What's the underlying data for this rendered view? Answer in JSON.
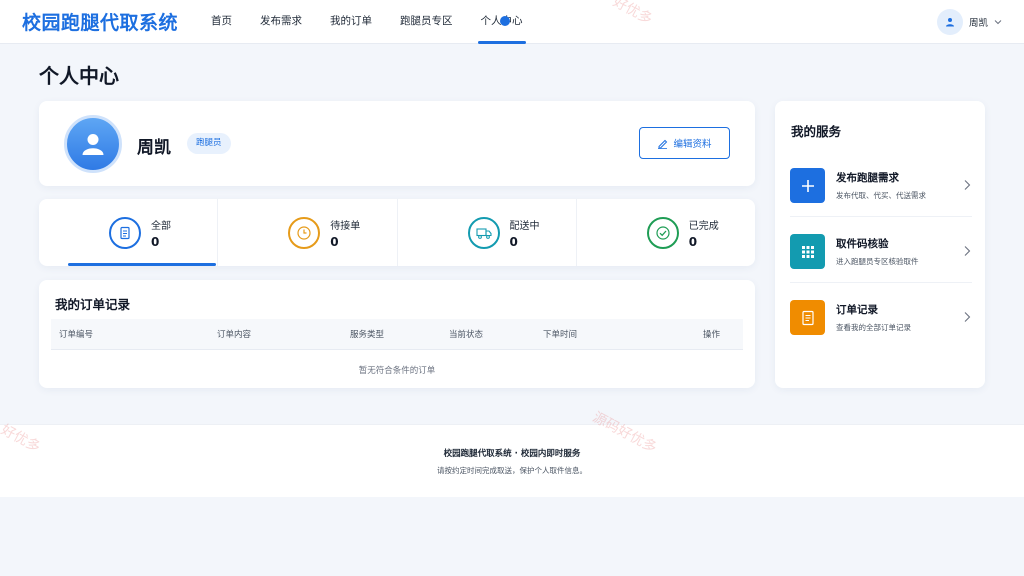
{
  "header": {
    "brand": "校园跑腿代取系统",
    "nav": [
      {
        "label": "首页"
      },
      {
        "label": "发布需求"
      },
      {
        "label": "我的订单"
      },
      {
        "label": "跑腿员专区"
      },
      {
        "label": "个人中心",
        "active": true
      }
    ],
    "user_name": "周凯"
  },
  "page_title": "个人中心",
  "profile": {
    "name": "周凯",
    "role": "跑腿员",
    "edit_label": "编辑资料"
  },
  "stats": [
    {
      "label": "全部",
      "value": "0",
      "icon": "document-icon",
      "color": "#1d6fe0"
    },
    {
      "label": "待接单",
      "value": "0",
      "icon": "clock-icon",
      "color": "#e69b1a"
    },
    {
      "label": "配送中",
      "value": "0",
      "icon": "truck-icon",
      "color": "#139bb0"
    },
    {
      "label": "已完成",
      "value": "0",
      "icon": "check-circle-icon",
      "color": "#1f9d55"
    }
  ],
  "orders": {
    "title": "我的订单记录",
    "columns": [
      "订单编号",
      "订单内容",
      "服务类型",
      "当前状态",
      "下单时间",
      "操作"
    ],
    "empty_text": "暂无符合条件的订单"
  },
  "services": {
    "title": "我的服务",
    "items": [
      {
        "title": "发布跑腿需求",
        "desc": "发布代取、代买、代送需求",
        "icon": "plus-icon",
        "color": "#1d6fe0"
      },
      {
        "title": "取件码核验",
        "desc": "进入跑腿员专区核验取件",
        "icon": "grid-icon",
        "color": "#139bb0"
      },
      {
        "title": "订单记录",
        "desc": "查看我的全部订单记录",
        "icon": "list-icon",
        "color": "#f08c00"
      }
    ]
  },
  "footer": {
    "line1": "校园跑腿代取系统 · 校园内即时服务",
    "line2": "请按约定时间完成取送，保护个人取件信息。"
  },
  "watermark": {
    "text_a": "源码好优多",
    "text_b": "好优多"
  },
  "colors": {
    "primary": "#1d6fe0",
    "pending": "#e69b1a",
    "delivering": "#139bb0",
    "done": "#1f9d55"
  }
}
